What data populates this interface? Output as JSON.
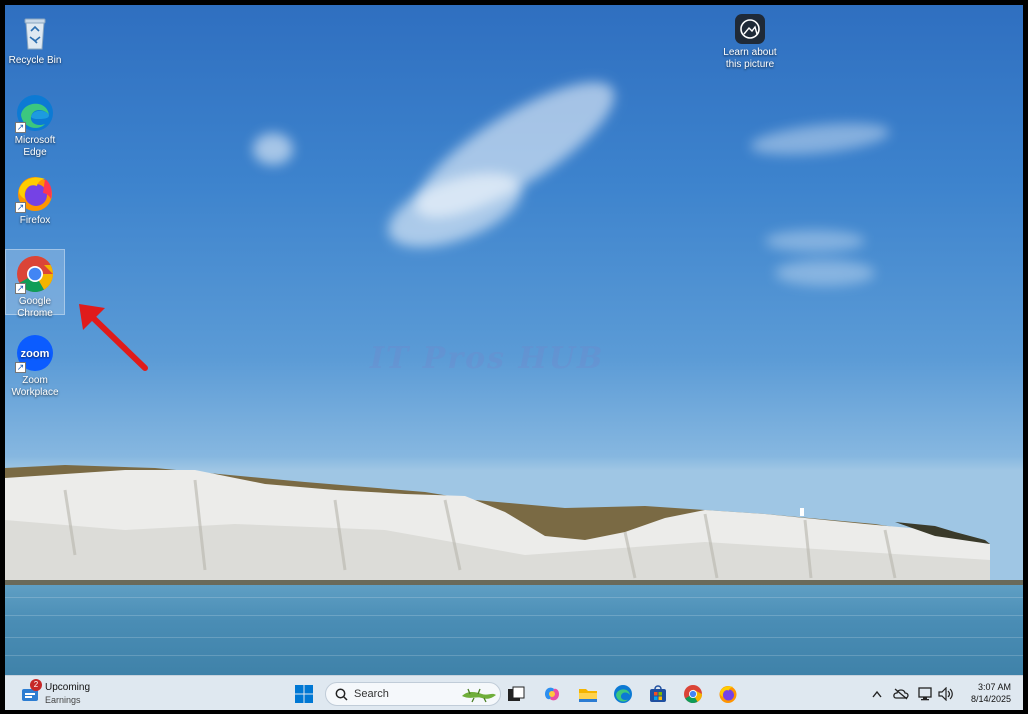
{
  "desktop_icons": [
    {
      "label": "Recycle Bin",
      "icon": "recycle-bin-icon"
    },
    {
      "label": "Microsoft Edge",
      "icon": "edge-icon"
    },
    {
      "label": "Firefox",
      "icon": "firefox-icon"
    },
    {
      "label": "Google Chrome",
      "icon": "chrome-icon",
      "selected": true
    },
    {
      "label": "Zoom Workplace",
      "icon": "zoom-icon"
    }
  ],
  "learn_about": {
    "label_line1": "Learn about",
    "label_line2": "this picture"
  },
  "icon_texts": {
    "zoom": "zoom"
  },
  "watermark": "IT Pros HUB",
  "taskbar": {
    "weather": {
      "title": "Upcoming",
      "subtitle": "Earnings",
      "badge_count": "2"
    },
    "search_label": "Search",
    "pinned": [
      "windows-start-icon",
      "task-view-icon",
      "copilot-icon",
      "file-explorer-icon",
      "edge-icon",
      "store-icon",
      "chrome-icon",
      "firefox-icon"
    ],
    "tray": {
      "time": "3:07 AM",
      "date": "8/14/2025"
    }
  },
  "colors": {
    "accent_red": "#e01b1b",
    "taskbar_bg": "#dfe8f0"
  }
}
